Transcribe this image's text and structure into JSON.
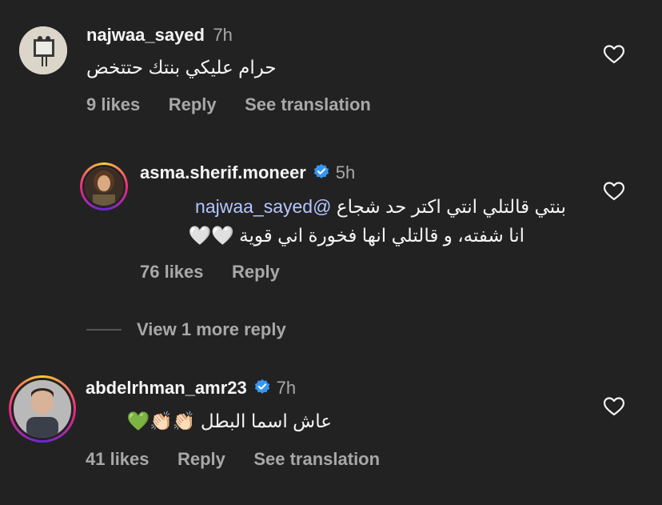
{
  "comments": [
    {
      "username": "najwaa_sayed",
      "time": "7h",
      "text": "حرام عليكي بنتك حتتخض",
      "likes": "9 likes",
      "reply": "Reply",
      "translate": "See translation"
    },
    {
      "username": "asma.sherif.moneer",
      "time": "5h",
      "mention": "@najwaa_sayed",
      "text_line1": "بنتي قالتلي انتي اكتر حد شجاع",
      "text_line2": "انا شفته، و قالتلي انها فخورة اني قوية",
      "emoji_line2": "🤍🤍",
      "likes": "76 likes",
      "reply": "Reply",
      "verified": true
    },
    {
      "username": "abdelrhman_amr23",
      "time": "7h",
      "text": "عاش اسما البطل",
      "emoji": "👏🏻👏🏻💚",
      "likes": "41 likes",
      "reply": "Reply",
      "translate": "See translation",
      "verified": true
    }
  ],
  "view_more": "View 1 more reply",
  "colors": {
    "background": "#222222",
    "muted": "#a8a8a8",
    "text": "#f5f5f5",
    "verified": "#3797f0",
    "mention": "#b4c6ff"
  }
}
